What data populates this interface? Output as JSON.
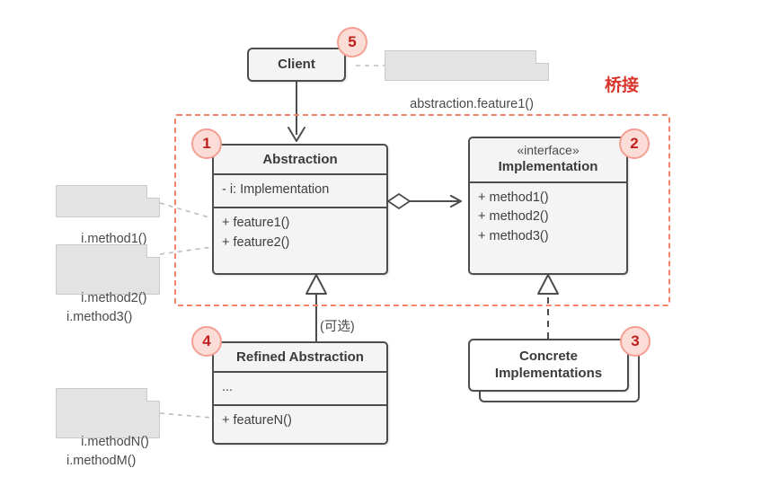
{
  "diagram": {
    "title": "Bridge pattern UML class diagram",
    "group": {
      "label": "桥接",
      "color": "#f4816a"
    },
    "edge_labels": {
      "optional": "(可选)"
    }
  },
  "boxes": {
    "client": {
      "name": "Client"
    },
    "abstraction": {
      "name": "Abstraction",
      "fields": [
        "- i: Implementation"
      ],
      "methods": [
        "+ feature1()",
        "+ feature2()"
      ]
    },
    "implementation": {
      "stereotype": "«interface»",
      "name": "Implementation",
      "methods": [
        "+ method1()",
        "+ method2()",
        "+ method3()"
      ]
    },
    "refined_abstraction": {
      "name": "Refined Abstraction",
      "fields": [
        "..."
      ],
      "methods": [
        "+ featureN()"
      ]
    },
    "concrete_implementations": {
      "name_line1": "Concrete",
      "name_line2": "Implementations"
    }
  },
  "notes": {
    "client_call": "abstraction.feature1()",
    "feature1_body": "i.method1()",
    "feature2_body": "i.method2()\ni.method3()",
    "featureN_body": "i.methodN()\ni.methodM()"
  },
  "badges": {
    "abstraction": "1",
    "implementation": "2",
    "concrete_implementations": "3",
    "refined_abstraction": "4",
    "client": "5"
  }
}
